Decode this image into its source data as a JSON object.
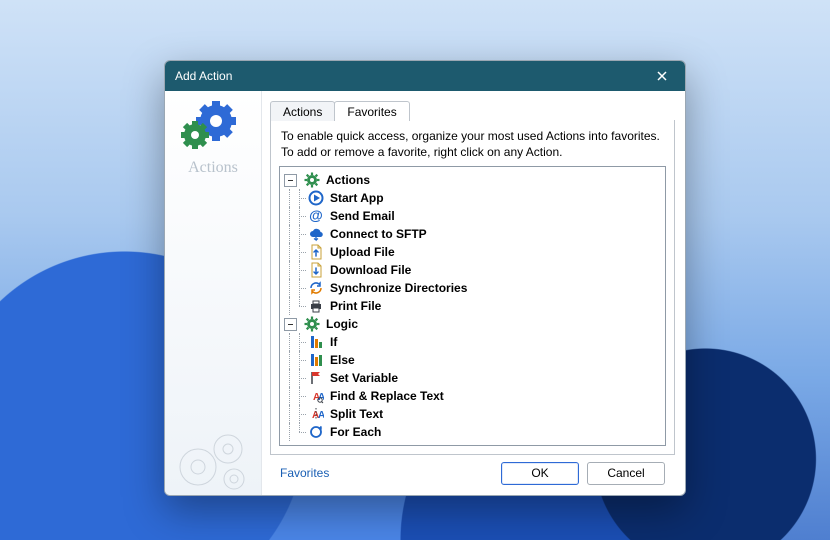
{
  "dialog": {
    "title": "Add Action",
    "sidebar_label": "Actions"
  },
  "tabs": {
    "items": [
      "Actions",
      "Favorites"
    ],
    "active_index": 1
  },
  "hint": {
    "line1": "To enable quick access, organize your most used Actions into favorites.",
    "line2": "To add or remove a favorite, right click on any Action."
  },
  "tree": [
    {
      "label": "Actions",
      "icon": "gear-icon",
      "expanded": true,
      "children": [
        {
          "label": "Start App",
          "icon": "play-icon"
        },
        {
          "label": "Send Email",
          "icon": "at-icon"
        },
        {
          "label": "Connect to SFTP",
          "icon": "cloud-icon"
        },
        {
          "label": "Upload File",
          "icon": "file-up-icon"
        },
        {
          "label": "Download File",
          "icon": "file-down-icon"
        },
        {
          "label": "Synchronize Directories",
          "icon": "sync-icon"
        },
        {
          "label": "Print File",
          "icon": "print-icon"
        }
      ]
    },
    {
      "label": "Logic",
      "icon": "gear-icon",
      "expanded": true,
      "children": [
        {
          "label": "If",
          "icon": "bars-if-icon"
        },
        {
          "label": "Else",
          "icon": "bars-else-icon"
        },
        {
          "label": "Set Variable",
          "icon": "flag-icon"
        },
        {
          "label": "Find & Replace Text",
          "icon": "aa-search-icon"
        },
        {
          "label": "Split Text",
          "icon": "aa-split-icon"
        },
        {
          "label": "For Each",
          "icon": "loop-icon"
        }
      ]
    }
  ],
  "footer": {
    "link": "Favorites",
    "ok": "OK",
    "cancel": "Cancel"
  },
  "colors": {
    "titlebar": "#1d5a6e",
    "accent": "#2e6ad6"
  }
}
